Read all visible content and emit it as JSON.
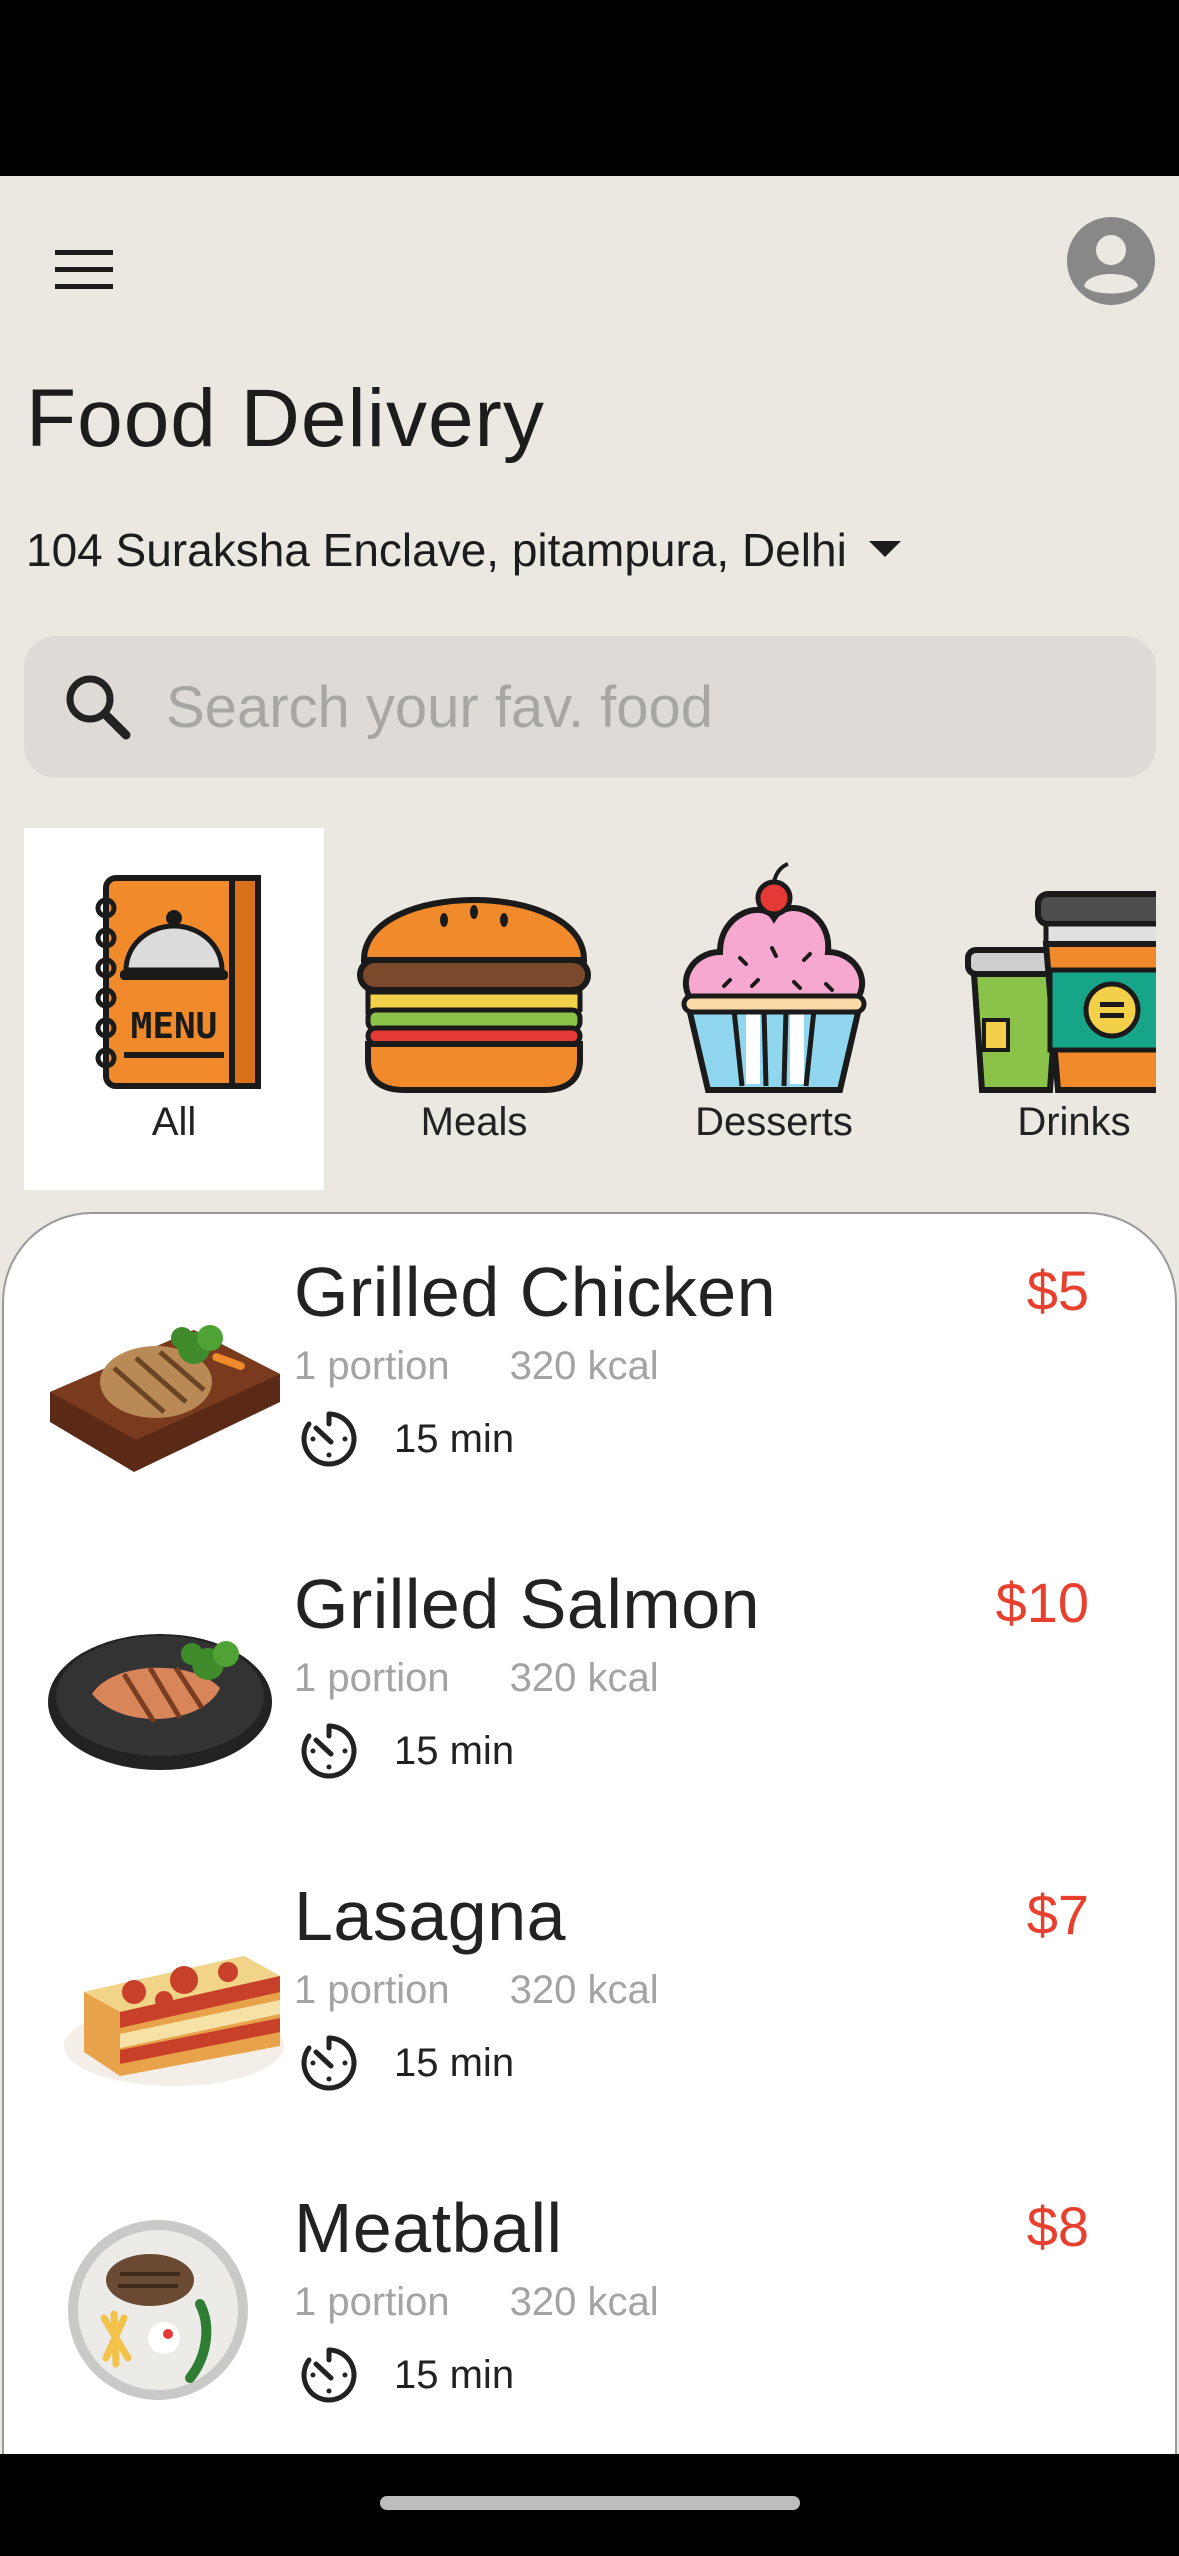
{
  "header": {
    "menu_icon": "hamburger-menu-icon",
    "avatar_icon": "account-circle-icon",
    "title": "Food Delivery",
    "address": "104 Suraksha Enclave, pitampura, Delhi",
    "address_dropdown_icon": "caret-down-icon"
  },
  "search": {
    "placeholder": "Search your fav. food",
    "icon": "search-icon"
  },
  "categories": [
    {
      "label": "All",
      "icon": "menu-book-icon",
      "selected": true
    },
    {
      "label": "Meals",
      "icon": "burger-icon",
      "selected": false
    },
    {
      "label": "Desserts",
      "icon": "cupcake-icon",
      "selected": false
    },
    {
      "label": "Drinks",
      "icon": "drink-cups-icon",
      "selected": false
    }
  ],
  "items": [
    {
      "name": "Grilled Chicken",
      "price": "$5",
      "portion": "1 portion",
      "kcal": "320 kcal",
      "time": "15 min",
      "image": "grilled-chicken-photo"
    },
    {
      "name": "Grilled Salmon",
      "price": "$10",
      "portion": "1 portion",
      "kcal": "320 kcal",
      "time": "15 min",
      "image": "grilled-salmon-photo"
    },
    {
      "name": "Lasagna",
      "price": "$7",
      "portion": "1 portion",
      "kcal": "320 kcal",
      "time": "15 min",
      "image": "lasagna-photo"
    },
    {
      "name": "Meatball",
      "price": "$8",
      "portion": "1 portion",
      "kcal": "320 kcal",
      "time": "15 min",
      "image": "meatball-photo"
    }
  ],
  "colors": {
    "background": "#ebe7e1",
    "price": "#e8402f",
    "search_bg": "#dedad5",
    "accent_orange": "#f08a2b"
  }
}
